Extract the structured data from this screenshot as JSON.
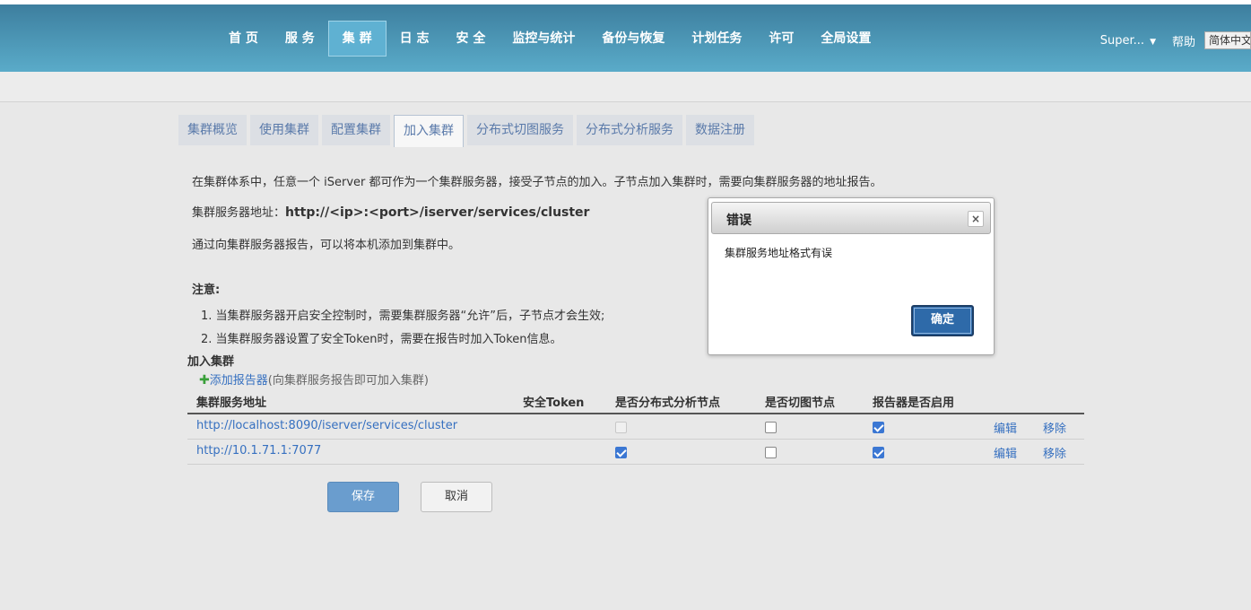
{
  "nav": {
    "items": [
      {
        "label": "首 页"
      },
      {
        "label": "服 务"
      },
      {
        "label": "集 群"
      },
      {
        "label": "日 志"
      },
      {
        "label": "安 全"
      },
      {
        "label": "监控与统计"
      },
      {
        "label": "备份与恢复"
      },
      {
        "label": "计划任务"
      },
      {
        "label": "许可"
      },
      {
        "label": "全局设置"
      }
    ],
    "active_index": 2
  },
  "user": {
    "name": "Super...",
    "help": "帮助",
    "language": "简体中文"
  },
  "tabs": {
    "items": [
      {
        "label": "集群概览"
      },
      {
        "label": "使用集群"
      },
      {
        "label": "配置集群"
      },
      {
        "label": "加入集群"
      },
      {
        "label": "分布式切图服务"
      },
      {
        "label": "分布式分析服务"
      },
      {
        "label": "数据注册"
      }
    ],
    "active_index": 3
  },
  "content": {
    "intro": "在集群体系中，任意一个 iServer 都可作为一个集群服务器，接受子节点的加入。子节点加入集群时，需要向集群服务器的地址报告。",
    "address_label": "集群服务器地址：",
    "address_value": "http://<ip>:<port>/iserver/services/cluster",
    "report_text": "通过向集群服务器报告，可以将本机添加到集群中。",
    "note_title": "注意:",
    "note1": "1. 当集群服务器开启安全控制时，需要集群服务器“允许”后，子节点才会生效;",
    "note2": "2. 当集群服务器设置了安全Token时，需要在报告时加入Token信息。",
    "join_title": "加入集群",
    "add_reporter": "添加报告器",
    "add_reporter_hint": "(向集群服务报告即可加入集群)"
  },
  "table": {
    "headers": {
      "address": "集群服务地址",
      "token": "安全Token",
      "analysis": "是否分布式分析节点",
      "tile": "是否切图节点",
      "enabled": "报告器是否启用"
    },
    "rows": [
      {
        "url": "http://localhost:8090/iserver/services/cluster",
        "analysis": "disabled",
        "tile": false,
        "enabled": true,
        "edit": "编辑",
        "remove": "移除"
      },
      {
        "url": "http://10.1.71.1:7077",
        "analysis": true,
        "tile": false,
        "enabled": true,
        "edit": "编辑",
        "remove": "移除"
      }
    ]
  },
  "buttons": {
    "save": "保存",
    "cancel": "取消"
  },
  "dialog": {
    "title": "错误",
    "close": "×",
    "message": "集群服务地址格式有误",
    "ok": "确定"
  }
}
